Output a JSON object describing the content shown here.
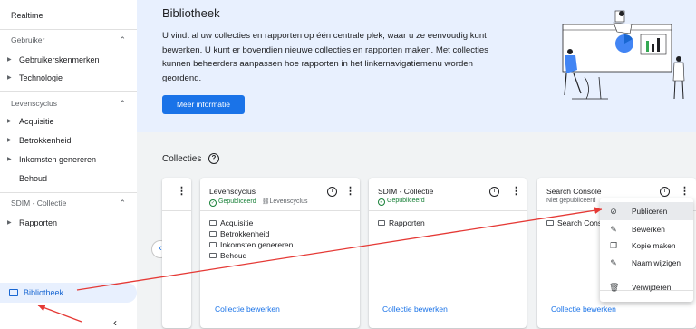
{
  "sidebar": {
    "realtime": "Realtime",
    "section_gebruiker": "Gebruiker",
    "gebruikerskenmerken": "Gebruikerskenmerken",
    "technologie": "Technologie",
    "section_levenscyclus": "Levenscyclus",
    "acquisitie": "Acquisitie",
    "betrokkenheid": "Betrokkenheid",
    "inkomsten": "Inkomsten genereren",
    "behoud": "Behoud",
    "section_sdim": "SDIM - Collectie",
    "rapporten": "Rapporten",
    "bibliotheek": "Bibliotheek"
  },
  "hero": {
    "title": "Bibliotheek",
    "text": "U vindt al uw collecties en rapporten op één centrale plek, waar u ze eenvoudig kunt bewerken. U kunt er bovendien nieuwe collecties en rapporten maken. Met collecties kunnen beheerders aanpassen hoe rapporten in het linkernavigatiemenu worden geordend.",
    "button": "Meer informatie"
  },
  "main": {
    "title": "Collecties",
    "cards": [
      {
        "title": "Levenscyclus",
        "status": "Gepubliceerd",
        "link": "Levenscyclus",
        "items": [
          "Acquisitie",
          "Betrokkenheid",
          "Inkomsten genereren",
          "Behoud"
        ],
        "edit": "Collectie bewerken"
      },
      {
        "title": "SDIM - Collectie",
        "status": "Gepubliceerd",
        "items": [
          "Rapporten"
        ],
        "edit": "Collectie bewerken"
      },
      {
        "title": "Search Console",
        "status": "Niet gepubliceerd",
        "items": [
          "Search Conso"
        ],
        "edit": "Collectie bewerken"
      }
    ]
  },
  "menu": {
    "items": [
      "Publiceren",
      "Bewerken",
      "Kopie maken",
      "Naam wijzigen",
      "Verwijderen"
    ]
  },
  "colors": {
    "accent": "#1a73e8",
    "arrow": "#e53935",
    "published": "#188038",
    "hero_bg": "#e8f0fe"
  }
}
